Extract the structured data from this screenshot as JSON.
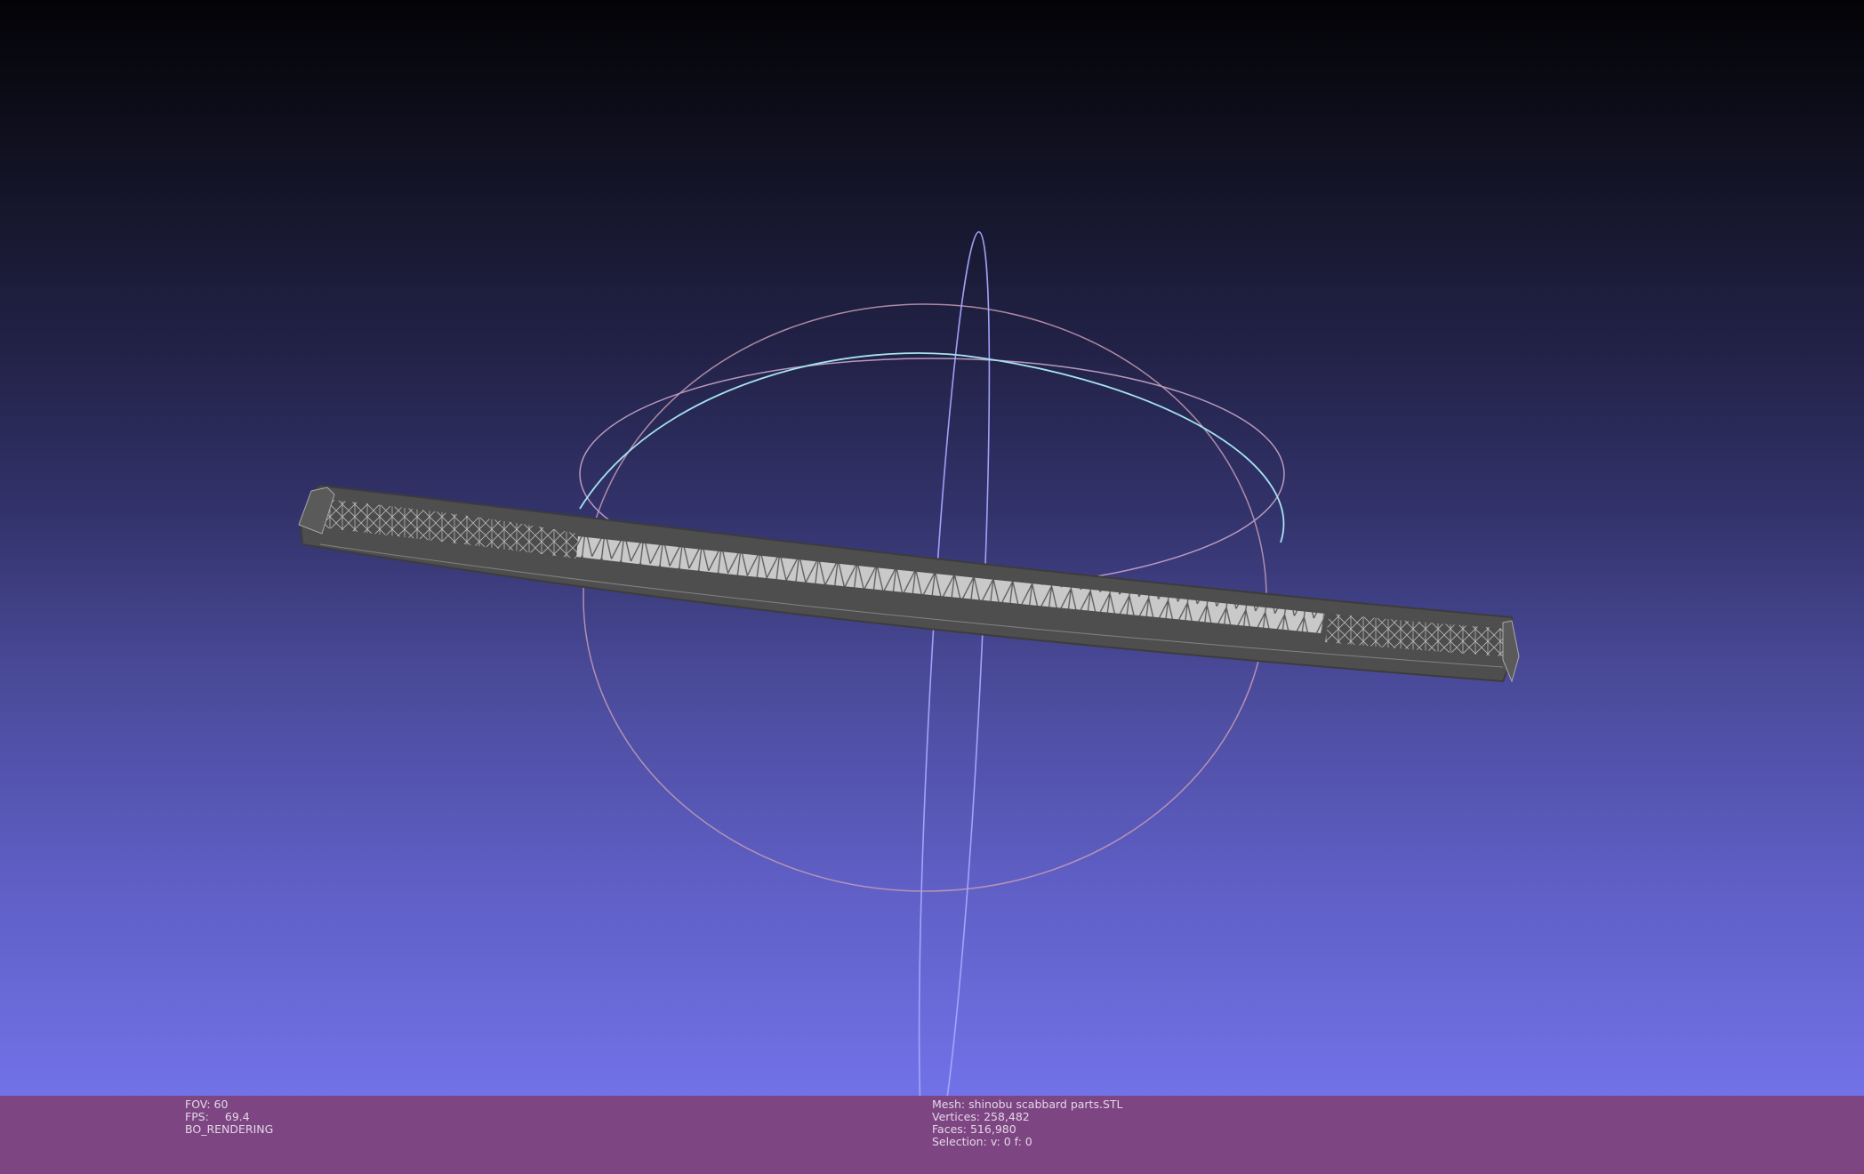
{
  "viewer": {
    "background_top": "#030306",
    "background_bottom": "#7272e8",
    "status_bar_color": "#7d4582",
    "mesh_color": "#505050",
    "mesh_highlight": "#c9c9c9",
    "trackball_colors": [
      "#9ea3ff",
      "#c8a0b8",
      "#9fd9e6"
    ]
  },
  "status": {
    "fov_label": "FOV:",
    "fov_value": "60",
    "fps_label": "FPS:",
    "fps_value": "69.4",
    "render_mode": "BO_RENDERING",
    "mesh_label": "Mesh:",
    "mesh_name": "shinobu scabbard parts.STL",
    "vertices_label": "Vertices:",
    "vertices_value": "258,482",
    "faces_label": "Faces:",
    "faces_value": "516,980",
    "selection_label": "Selection:",
    "selection_value": "v: 0 f: 0"
  }
}
